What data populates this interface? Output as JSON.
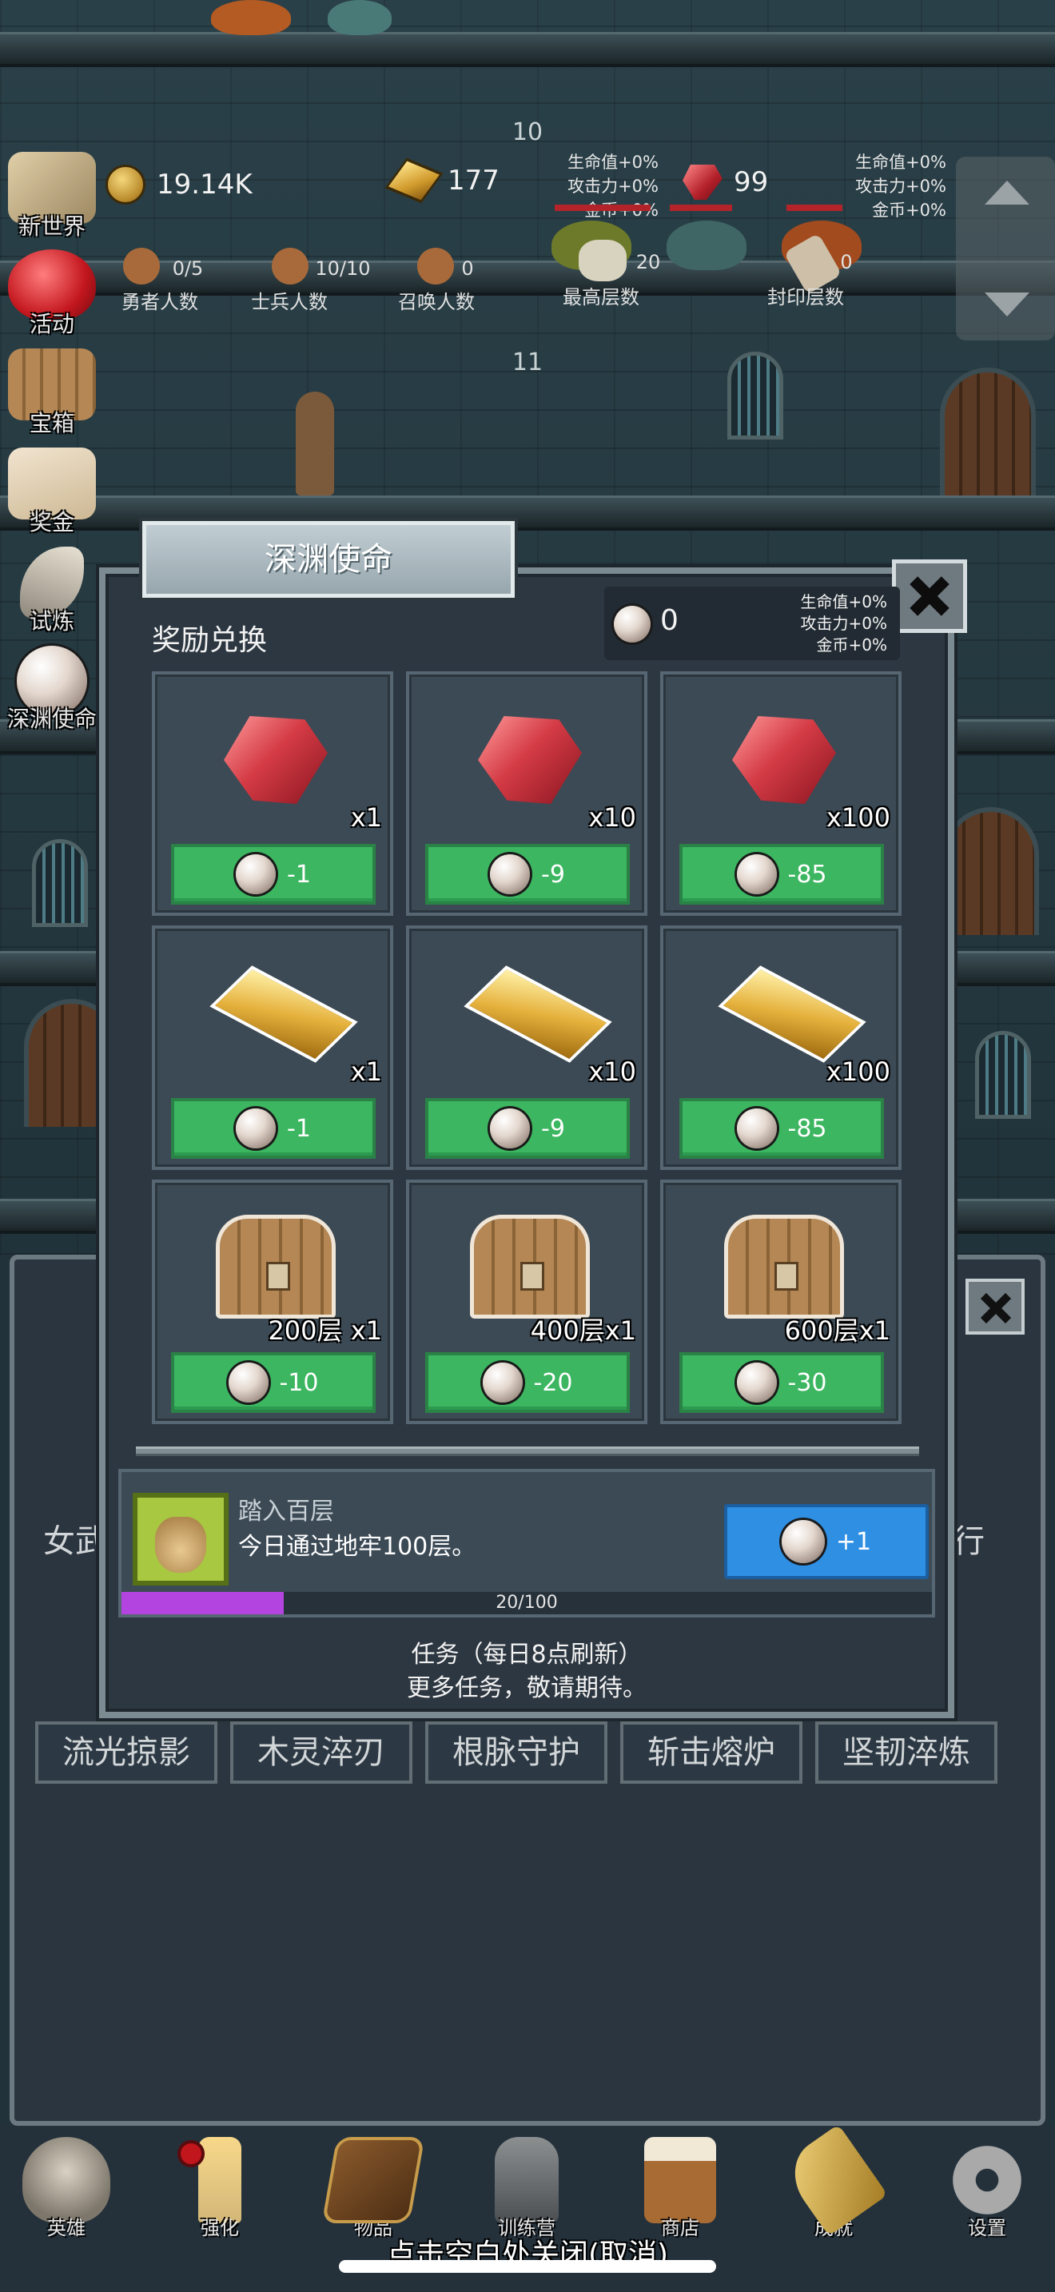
{
  "colors": {
    "buy_button": "#3cb660",
    "claim_button": "#2f8fe3",
    "progress_fill": "#b344e0",
    "panel": "#2d3741"
  },
  "floors": [
    "10",
    "11"
  ],
  "stats": {
    "coins": "19.14K",
    "gold": "177",
    "ruby": "99",
    "gold_bonus": [
      "生命值+0%",
      "攻击力+0%",
      "金币+0%"
    ],
    "ruby_bonus": [
      "生命值+0%",
      "攻击力+0%",
      "金币+0%"
    ],
    "heroes": {
      "value": "0/5",
      "label": "勇者人数"
    },
    "soldiers": {
      "value": "10/10",
      "label": "士兵人数"
    },
    "summons": {
      "value": "0",
      "label": "召唤人数"
    },
    "max_floor": {
      "value": "20",
      "label": "最高层数"
    },
    "sealed_floor": {
      "value": "0",
      "label": "封印层数"
    }
  },
  "side_menu": [
    {
      "label": "新世界",
      "icon": "map-icon"
    },
    {
      "label": "活动",
      "icon": "heart-icon"
    },
    {
      "label": "宝箱",
      "icon": "chest-icon"
    },
    {
      "label": "奖金",
      "icon": "envelope-icon"
    },
    {
      "label": "试炼",
      "icon": "feather-icon"
    },
    {
      "label": "深渊使命",
      "icon": "pearl-icon"
    }
  ],
  "background_panel": {
    "tile_labels": [
      "流光掠影",
      "木灵淬刃",
      "根脉守护",
      "斩击熔炉",
      "坚韧淬炼"
    ],
    "left_text": "女武",
    "right_text": "行"
  },
  "modal": {
    "title": "深渊使命",
    "section_label": "奖励兑换",
    "pearl_balance": "0",
    "pearl_bonus": [
      "生命值+0%",
      "攻击力+0%",
      "金币+0%"
    ],
    "items": [
      {
        "type": "ruby",
        "qty": "x1",
        "cost": "-1"
      },
      {
        "type": "ruby",
        "qty": "x10",
        "cost": "-9"
      },
      {
        "type": "ruby",
        "qty": "x100",
        "cost": "-85"
      },
      {
        "type": "gold",
        "qty": "x1",
        "cost": "-1"
      },
      {
        "type": "gold",
        "qty": "x10",
        "cost": "-9"
      },
      {
        "type": "gold",
        "qty": "x100",
        "cost": "-85"
      },
      {
        "type": "chest",
        "qty": "200层 x1",
        "cost": "-10"
      },
      {
        "type": "chest",
        "qty": "400层x1",
        "cost": "-20"
      },
      {
        "type": "chest",
        "qty": "600层x1",
        "cost": "-30"
      }
    ],
    "quest": {
      "title": "踏入百层",
      "description": "今日通过地牢100层。",
      "reward": "+1",
      "progress_text": "20/100",
      "progress_fraction": 0.2
    },
    "footer_line1": "任务（每日8点刷新）",
    "footer_line2": "更多任务，敬请期待。"
  },
  "bottom_nav": [
    {
      "label": "英雄",
      "icon": "skull-icon"
    },
    {
      "label": "强化",
      "icon": "candle-icon"
    },
    {
      "label": "物品",
      "icon": "book-icon"
    },
    {
      "label": "训练营",
      "icon": "lantern-icon"
    },
    {
      "label": "商店",
      "icon": "mug-icon"
    },
    {
      "label": "成就",
      "icon": "key-icon"
    },
    {
      "label": "设置",
      "icon": "gear-icon"
    }
  ],
  "dismiss_hint": "点击空白处关闭(取消)"
}
